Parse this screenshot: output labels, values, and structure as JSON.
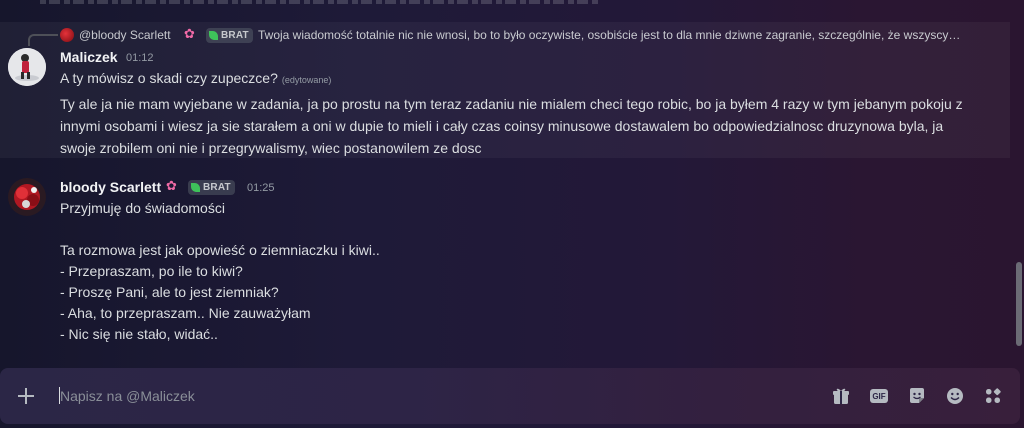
{
  "reply": {
    "author": "@bloody Scarlett",
    "tag": "BRAT",
    "text": "Twoja wiadomość totalnie nic nie wnosi, bo to było oczywiste, osobiście jest to dla mnie dziwne zagranie, szczególnie, że wszyscy…"
  },
  "messages": [
    {
      "author": "Maliczek",
      "time": "01:12",
      "lines": [
        "A ty mówisz o skadi czy zupeczce?",
        "Ty ale ja nie mam wyjebane w zadania, ja po prostu na tym teraz zadaniu nie mialem checi tego robic, bo ja byłem 4 razy w tym jebanym pokoju z",
        "innymi osobami i wiesz ja sie starałem a oni w dupie to mieli i cały czas coinsy minusowe dostawalem bo odpowiedzialnosc druzynowa byla, ja",
        "swoje zrobilem oni nie i przegrywalismy, wiec postanowilem ze dosc"
      ],
      "edited": "(edytowane)"
    },
    {
      "author": "bloody Scarlett",
      "tag": "BRAT",
      "time": "01:25",
      "lines": [
        "Przyjmuję do świadomości",
        "Ta rozmowa jest jak opowieść o ziemniaczku i kiwi..",
        "- Przepraszam, po ile to kiwi?",
        "- Proszę Pani, ale to jest ziemniak?",
        "- Aha, to przepraszam.. Nie zauważyłam",
        "- Nic się nie stało, widać.."
      ]
    }
  ],
  "composer": {
    "placeholder": "Napisz na @Maliczek",
    "gif_label": "GIF",
    "icons": [
      "plus-icon",
      "gift-icon",
      "gif-icon",
      "sticker-icon",
      "emoji-icon",
      "apps-icon"
    ]
  }
}
